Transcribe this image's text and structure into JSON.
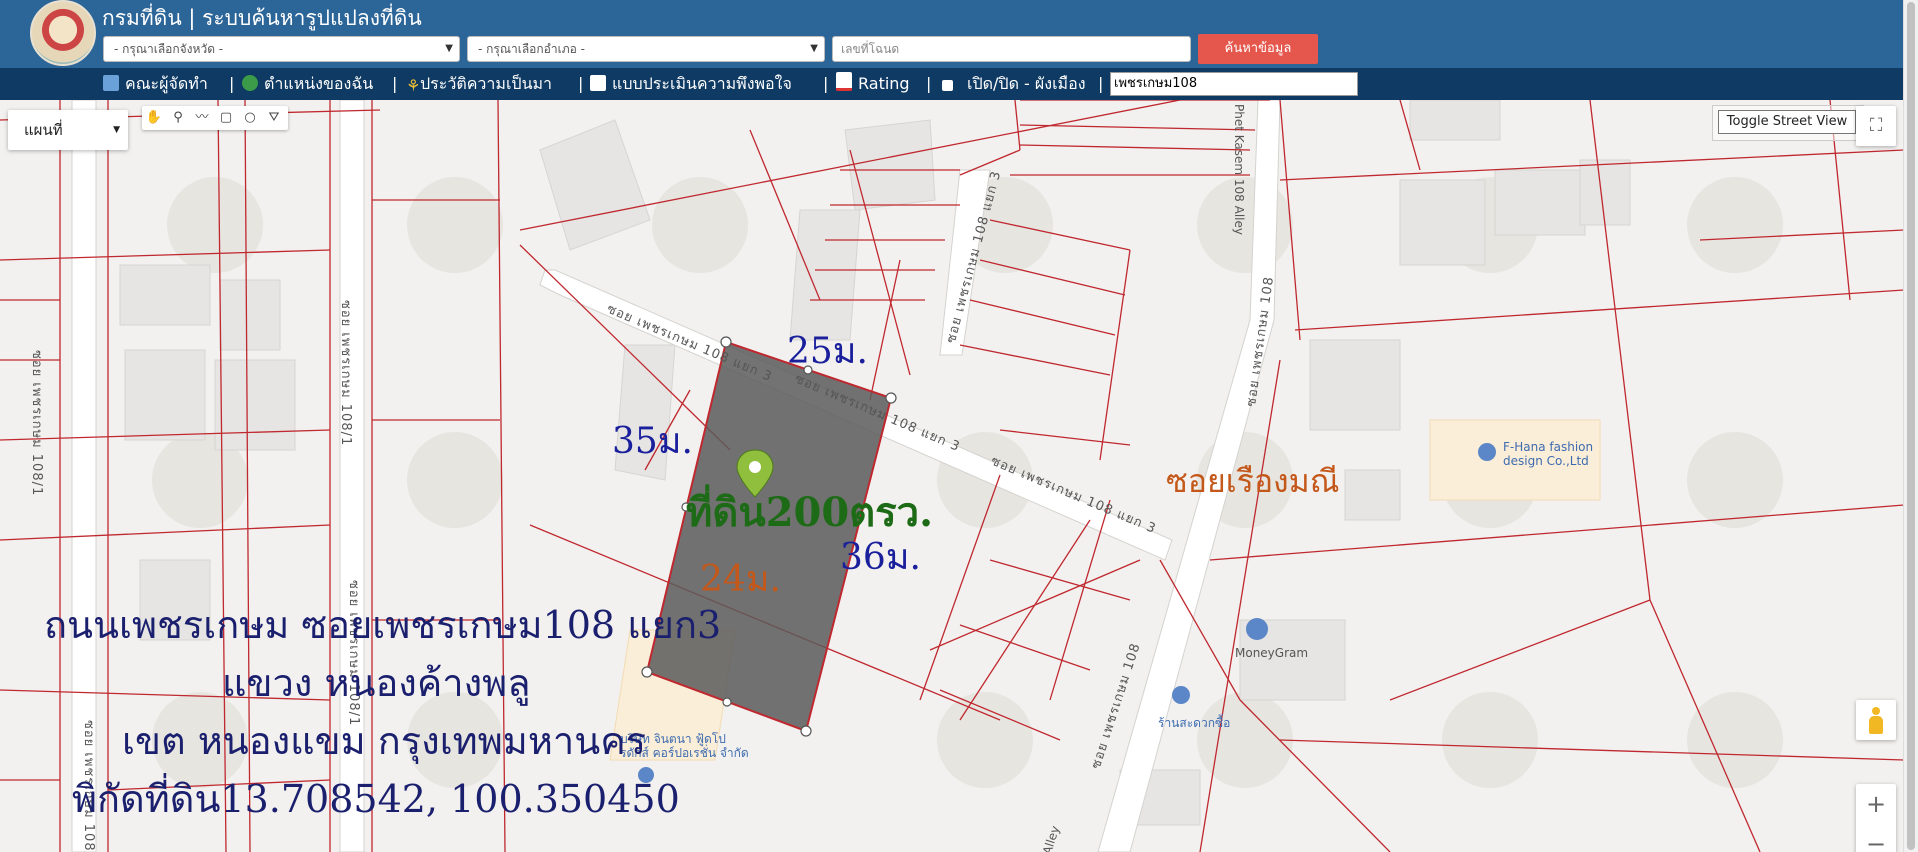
{
  "header": {
    "title": "กรมที่ดิน | ระบบค้นหารูปแปลงที่ดิน",
    "province_placeholder": "- กรุณาเลือกจังหวัด -",
    "district_placeholder": "- กรุณาเลือกอำเภอ -",
    "deed_placeholder": "เลขที่โฉนด",
    "search_button": "ค้นหาข้อมูล"
  },
  "nav": {
    "items": [
      {
        "label": "คณะผู้จัดทำ",
        "icon": "group-icon"
      },
      {
        "label": "ตำแหน่งของฉัน",
        "icon": "globe-icon"
      },
      {
        "label": "ประวัติความเป็นมา",
        "icon": "sprout-icon"
      },
      {
        "label": "แบบประเมินความพึงพอใจ",
        "icon": "form-icon"
      },
      {
        "label": "Rating",
        "icon": "chart-icon"
      },
      {
        "label": "เปิด/ปิด - ผังเมือง",
        "icon": "checkbox-icon"
      }
    ],
    "search_value": "เพชรเกษม108"
  },
  "map_controls": {
    "map_type": "แผนที่",
    "street_view_button": "Toggle Street View",
    "zoom_in": "+",
    "zoom_out": "−"
  },
  "map_labels": {
    "street_108_1_a": "ซอย เพชรเกษม 108/1",
    "street_108_1_b": "ซอย เพชรเกษม 108/1",
    "street_108_3_a": "ซอย เพชรเกษม 108 แยก 3",
    "street_108_3_b": "ซอย เพชรเกษม 108 แยก 3",
    "street_108_3_c": "ซอย เพชรเกษม 108 แยก 3",
    "street_108_3_d": "ซอย เพชรเกษม 108 แยก 3",
    "street_108_a": "ซอย เพชรเกษม 108",
    "street_108_b": "ซอย เพชรเกษม 108",
    "phet_kasem_alley": "Phet Kasem 108 Alley",
    "alley_bottom": "Alley",
    "poi_fhana": "F-Hana fashion design Co.,Ltd",
    "poi_moneygram": "MoneyGram",
    "poi_shop": "ร้านสะดวกซื้อ",
    "poi_company": "บริษัท จินตนา ฟู้ดโปรดักส์ คอร์ปอเรชั่น จำกัด"
  },
  "annotations": {
    "dim_top": "25ม.",
    "dim_left": "35ม.",
    "dim_right": "36ม.",
    "dim_bottom": "24ม.",
    "area": "ที่ดิน200ตรว.",
    "road_name": "ซอยเรืองมณี",
    "address_line1": "ถนนเพชรเกษม ซอยเพชรเกษม108 แยก3",
    "address_line2": "แขวง หนองค้างพลู",
    "address_line3": "เขต หนองแขม กรุงเทพมหานคร",
    "coords": "พิกัดที่ดิน13.708542, 100.350450"
  },
  "colors": {
    "header_bg": "#2c6597",
    "nav_bg": "#0f3a63",
    "search_btn": "#e5574d",
    "parcel_line": "#c0282f",
    "parcel_fill": "#5a5a5a",
    "dim_blue": "#1a1f9c",
    "dim_orange": "#c4581a",
    "area_green": "#1d6b16",
    "address_blue": "#1a1f6e"
  }
}
